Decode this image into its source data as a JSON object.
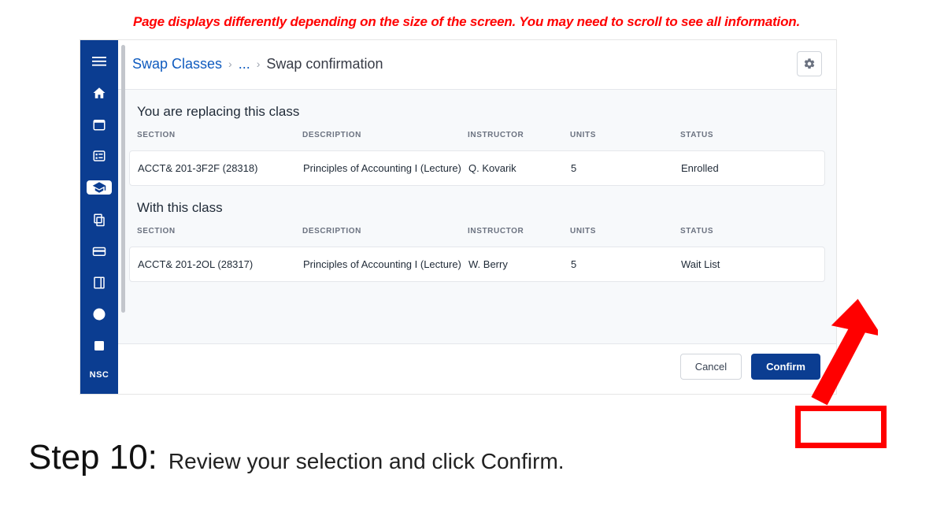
{
  "warning": "Page displays differently depending on the size of the screen. You may need to scroll to see all information.",
  "breadcrumb": {
    "root": "Swap Classes",
    "ellipsis": "...",
    "current": "Swap confirmation"
  },
  "section1": {
    "title": "You are replacing this class",
    "headers": {
      "section": "SECTION",
      "description": "DESCRIPTION",
      "instructor": "INSTRUCTOR",
      "units": "UNITS",
      "status": "STATUS"
    },
    "row": {
      "section": "ACCT& 201-3F2F (28318)",
      "description": "Principles of Accounting I (Lecture)",
      "instructor": "Q. Kovarik",
      "units": "5",
      "status": "Enrolled"
    }
  },
  "section2": {
    "title": "With this class",
    "headers": {
      "section": "SECTION",
      "description": "DESCRIPTION",
      "instructor": "INSTRUCTOR",
      "units": "UNITS",
      "status": "STATUS"
    },
    "row": {
      "section": "ACCT& 201-2OL (28317)",
      "description": "Principles of Accounting I (Lecture)",
      "instructor": "W. Berry",
      "units": "5",
      "status": "Wait List"
    }
  },
  "footer": {
    "cancel": "Cancel",
    "confirm": "Confirm"
  },
  "sidebar": {
    "nsc": "NSC",
    "icons": [
      "menu",
      "home",
      "calendar",
      "checklist",
      "graduation",
      "copy",
      "card",
      "book",
      "info",
      "person"
    ]
  },
  "step": {
    "label": "Step 10:",
    "text_pre": "Review your selection and click ",
    "text_bold": "Confirm",
    "text_post": "."
  }
}
